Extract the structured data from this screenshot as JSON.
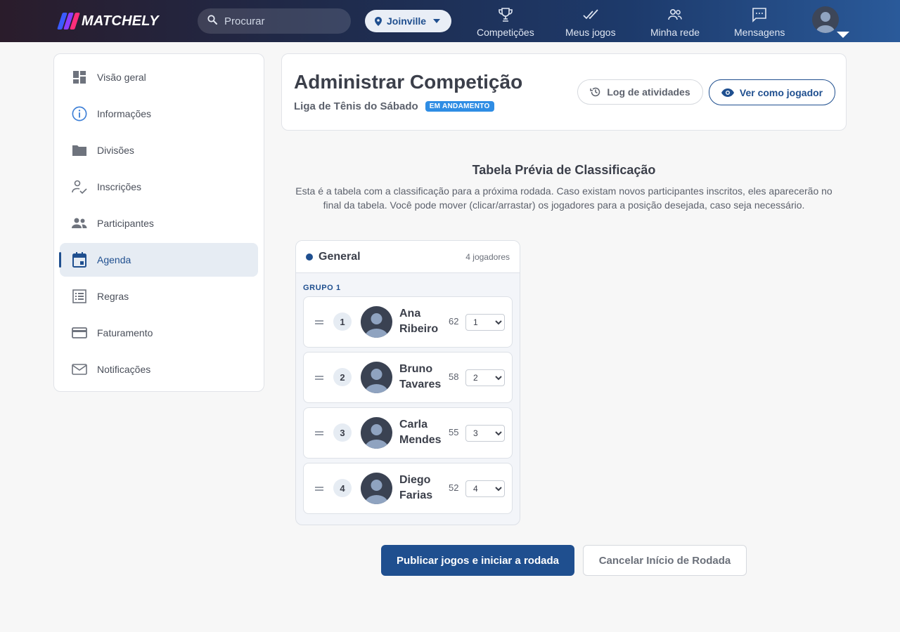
{
  "brand": {
    "name": "MATCHELY"
  },
  "search": {
    "placeholder": "Procurar"
  },
  "city": {
    "label": "Joinville"
  },
  "nav": [
    {
      "label": "Competições",
      "icon": "trophy-icon"
    },
    {
      "label": "Meus jogos",
      "icon": "double-check-icon"
    },
    {
      "label": "Minha rede",
      "icon": "people-icon"
    },
    {
      "label": "Mensagens",
      "icon": "chat-icon"
    }
  ],
  "sidebar": {
    "items": [
      {
        "label": "Visão geral",
        "icon": "dashboard-icon"
      },
      {
        "label": "Informações",
        "icon": "info-icon"
      },
      {
        "label": "Divisões",
        "icon": "folder-icon"
      },
      {
        "label": "Inscrições",
        "icon": "person-check-icon"
      },
      {
        "label": "Participantes",
        "icon": "people-icon"
      },
      {
        "label": "Agenda",
        "icon": "calendar-icon",
        "active": true
      },
      {
        "label": "Regras",
        "icon": "list-icon"
      },
      {
        "label": "Faturamento",
        "icon": "credit-card-icon"
      },
      {
        "label": "Notificações",
        "icon": "mail-icon"
      }
    ]
  },
  "header": {
    "title": "Administrar Competição",
    "subtitle": "Liga de Tênis do Sábado",
    "status": "EM ANDAMENTO",
    "log_label": "Log de atividades",
    "view_label": "Ver como jogador"
  },
  "preview": {
    "title": "Tabela Prévia de Classificação",
    "description": "Esta é a tabela com a classificação para a próxima rodada. Caso existam novos participantes inscritos, eles aparecerão no final da tabela. Você pode mover (clicar/arrastar) os jogadores para a posição desejada, caso seja necessário.",
    "division": "General",
    "player_count": "4 jogadores",
    "group": "GRUPO 1",
    "players": [
      {
        "pos": "1",
        "first": "Ana",
        "last": "Ribeiro",
        "score": "62",
        "selected": "1"
      },
      {
        "pos": "2",
        "first": "Bruno",
        "last": "Tavares",
        "score": "58",
        "selected": "2"
      },
      {
        "pos": "3",
        "first": "Carla",
        "last": "Mendes",
        "score": "55",
        "selected": "3"
      },
      {
        "pos": "4",
        "first": "Diego",
        "last": "Farias",
        "score": "52",
        "selected": "4"
      }
    ]
  },
  "actions": {
    "publish": "Publicar jogos e iniciar a rodada",
    "cancel": "Cancelar Início de Rodada"
  },
  "colors": {
    "primary": "#1f4f8f",
    "badge": "#2f8de4",
    "active_bg": "#e6ecf3"
  }
}
